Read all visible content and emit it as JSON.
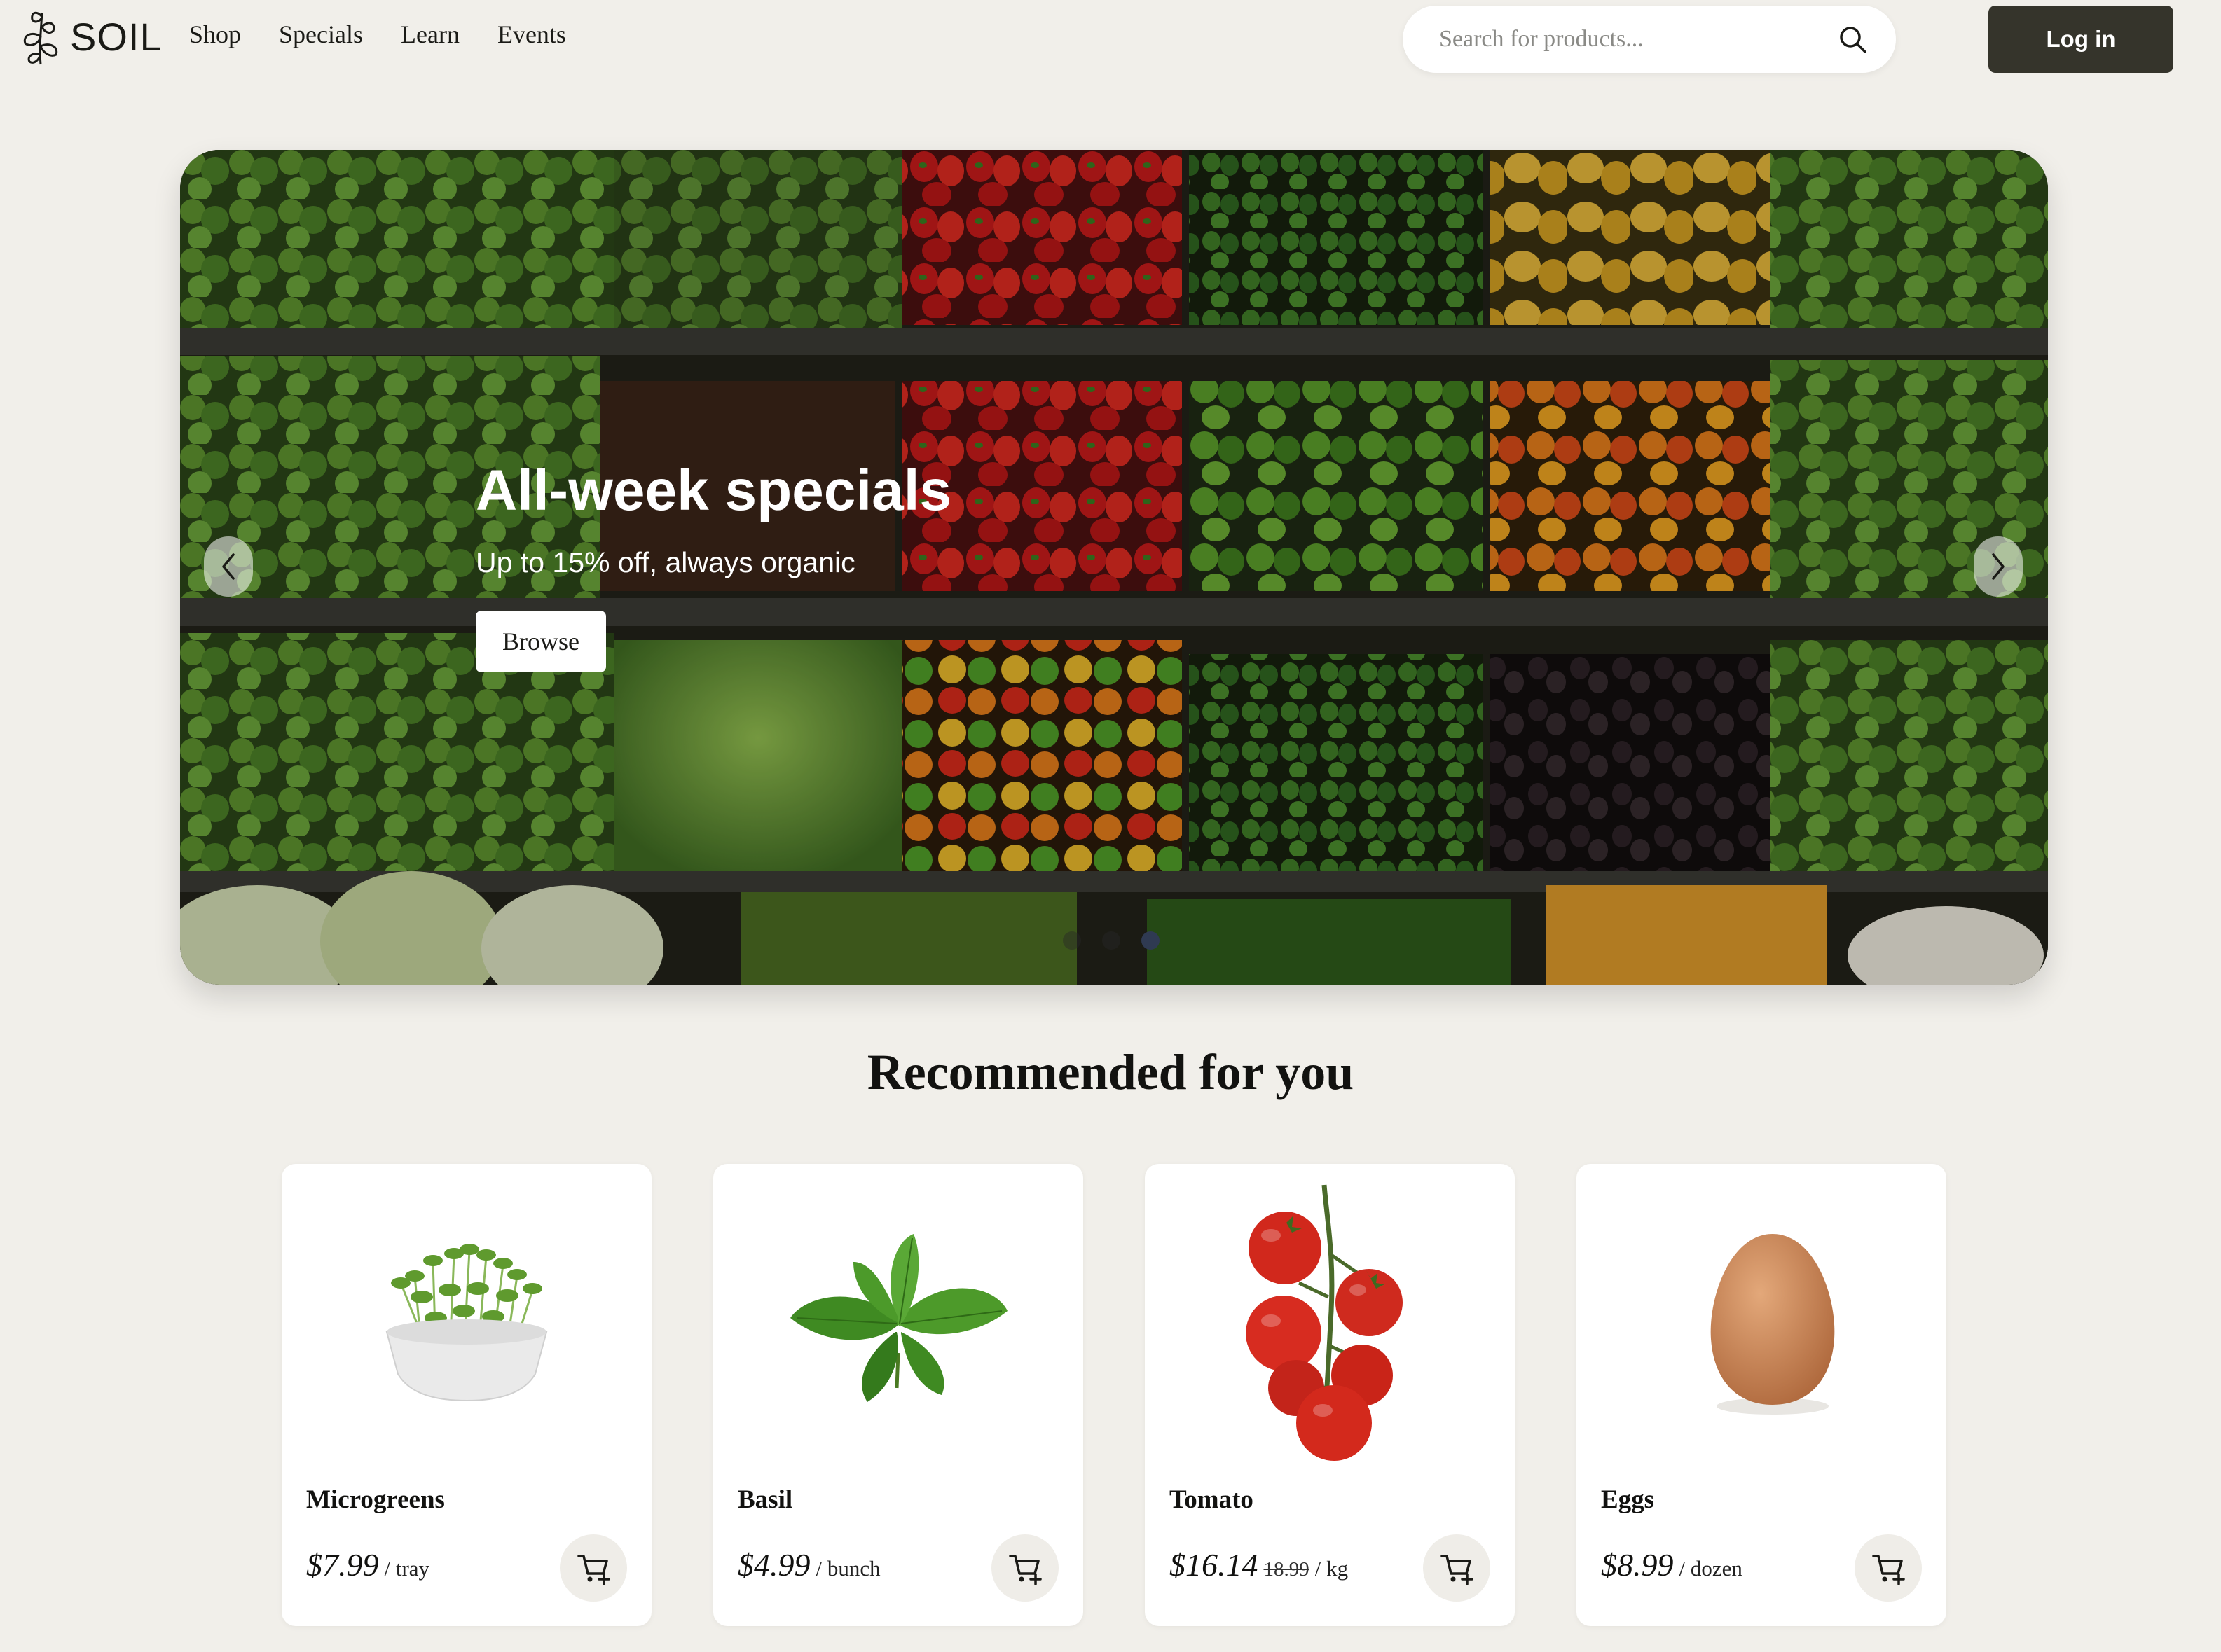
{
  "header": {
    "logo_text": "SOIL",
    "nav": [
      "Shop",
      "Specials",
      "Learn",
      "Events"
    ],
    "search_placeholder": "Search for products...",
    "login_label": "Log in"
  },
  "hero": {
    "title": "All-week specials",
    "subtitle": "Up to 15% off, always organic",
    "button_label": "Browse",
    "slide_count": 3,
    "active_slide": 3
  },
  "section": {
    "title": "Recommended for you"
  },
  "products": [
    {
      "name": "Microgreens",
      "price": "$7.99",
      "old_price": "",
      "unit": "/ tray",
      "icon": "microgreens-image"
    },
    {
      "name": "Basil",
      "price": "$4.99",
      "old_price": "",
      "unit": "/ bunch",
      "icon": "basil-image"
    },
    {
      "name": "Tomato",
      "price": "$16.14",
      "old_price": "18.99",
      "unit": "/ kg",
      "icon": "tomato-image"
    },
    {
      "name": "Eggs",
      "price": "$8.99",
      "old_price": "",
      "unit": "/ dozen",
      "icon": "egg-image"
    }
  ],
  "colors": {
    "background": "#f1efea",
    "login_button": "#35342b",
    "card": "#ffffff"
  }
}
